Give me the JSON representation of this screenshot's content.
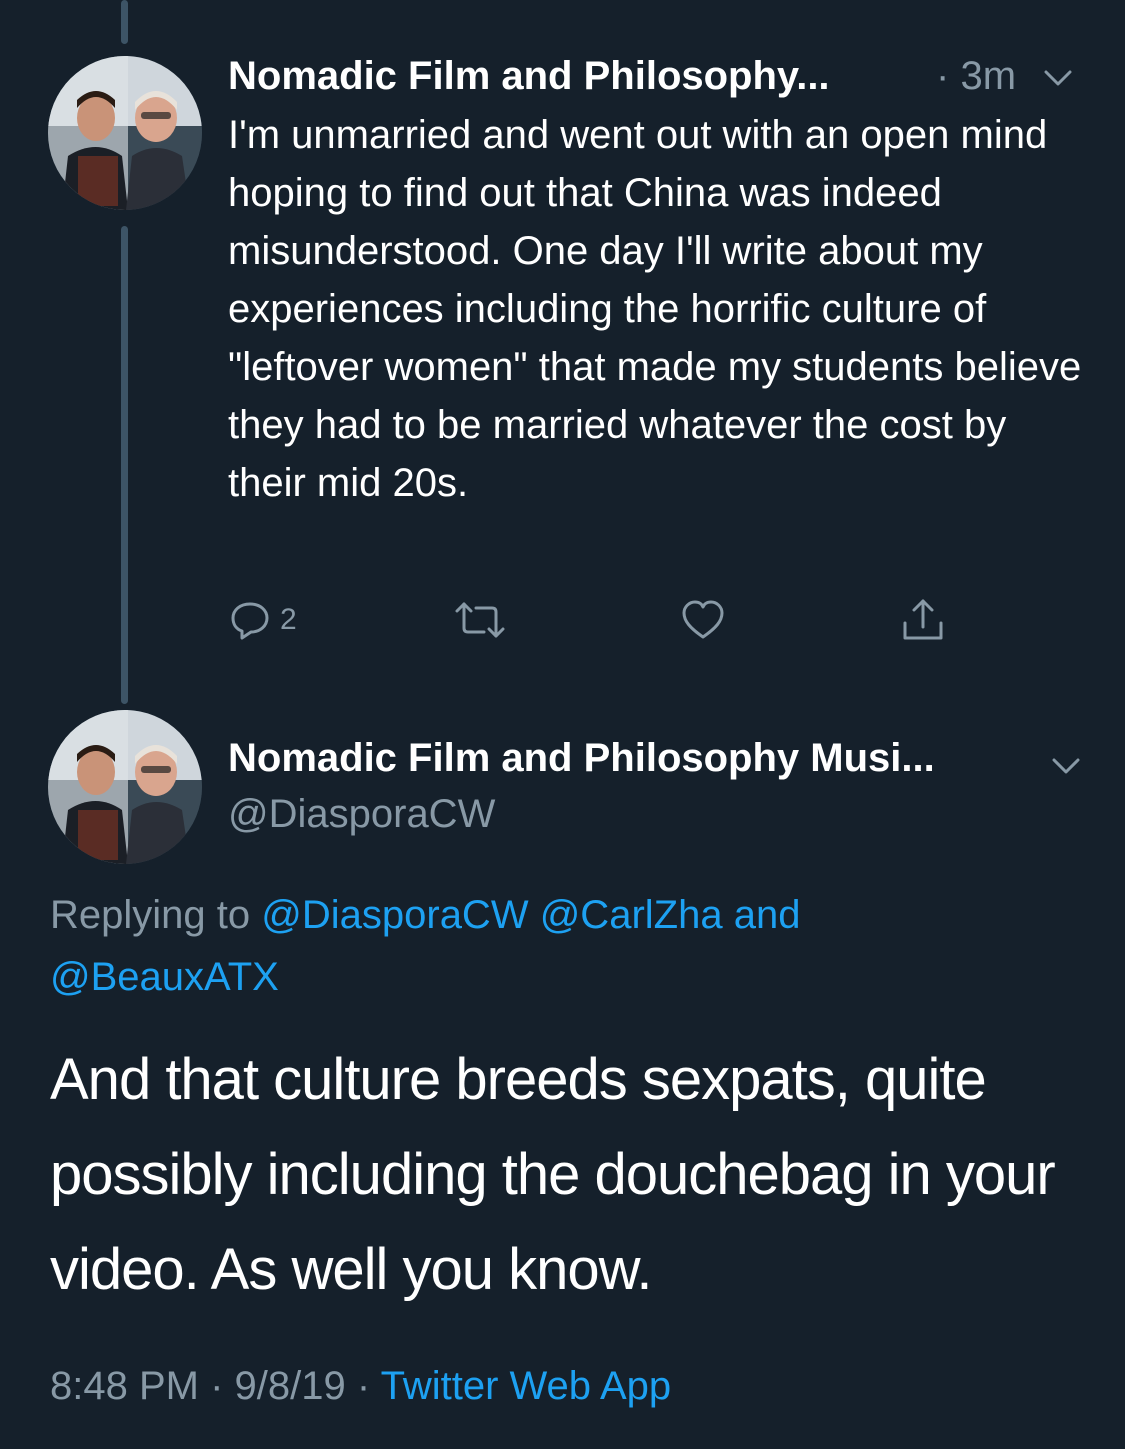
{
  "parent_tweet": {
    "display_name": "Nomadic Film and Philosophy...",
    "separator": "·",
    "time": "3m",
    "text": "I'm unmarried and went out with an open mind hoping to find out that China was indeed misunderstood. One day I'll write about my experiences including the horrific culture of \"leftover women\" that made my students believe they had to be married whatever the cost by their mid 20s.",
    "reply_count": "2",
    "icons": [
      "reply-icon",
      "retweet-icon",
      "like-icon",
      "share-icon",
      "chevron-down-icon"
    ]
  },
  "main_tweet": {
    "display_name": "Nomadic Film and Philosophy Musi...",
    "handle": "@DiasporaCW",
    "replying_prefix": "Replying to",
    "replying_handle_1": "@DiasporaCW",
    "replying_handle_2": "@CarlZha",
    "replying_and": "and",
    "replying_handle_3": "@BeauxATX",
    "text": "And that culture breeds sexpats, quite possibly including the douchebag in your video. As well you know.",
    "time": "8:48 PM",
    "date": "9/8/19",
    "sep": "·",
    "source": "Twitter Web App"
  },
  "colors": {
    "background": "#15202b",
    "text_primary": "#ffffff",
    "text_secondary": "#8899a6",
    "link": "#1da1f2",
    "thread_line": "#3d5466"
  }
}
